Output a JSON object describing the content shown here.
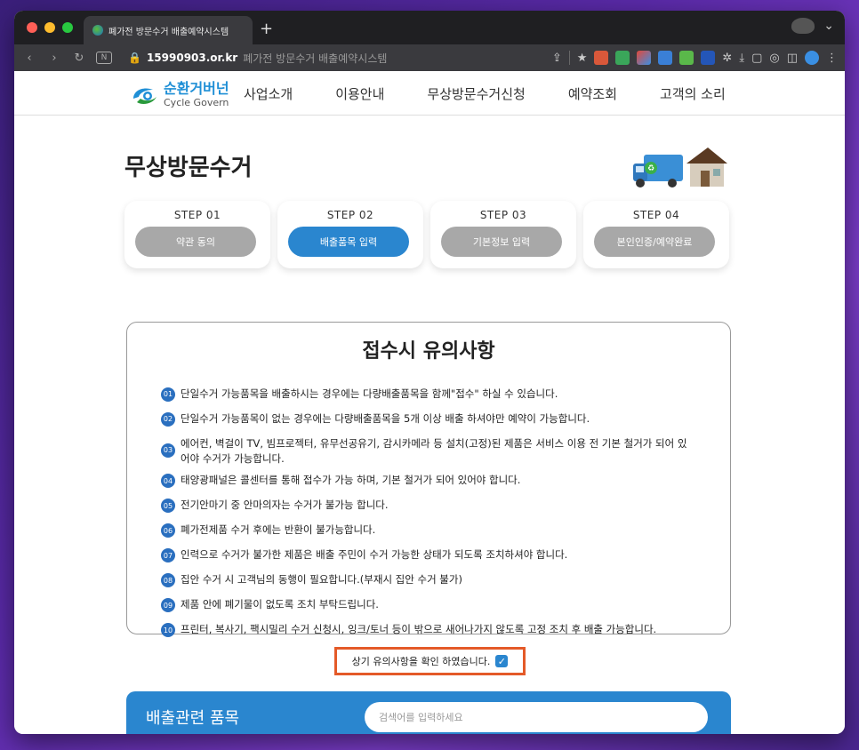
{
  "browser": {
    "tab_title": "폐가전 방문수거 배출예약시스템",
    "new_tab": "+",
    "url_host": "15990903.or.kr",
    "url_title": "폐가전 방문수거 배출예약시스템",
    "traffic_colors": [
      "#ff5f57",
      "#febc2e",
      "#28c840"
    ]
  },
  "site": {
    "logo_ko": "순환거버넌",
    "logo_en": "Cycle Govern",
    "nav": [
      "사업소개",
      "이용안내",
      "무상방문수거신청",
      "예약조회",
      "고객의 소리"
    ]
  },
  "page": {
    "title": "무상방문수거",
    "steps": [
      {
        "num": "STEP 01",
        "label": "약관 동의",
        "active": false
      },
      {
        "num": "STEP 02",
        "label": "배출품목 입력",
        "active": true
      },
      {
        "num": "STEP 03",
        "label": "기본정보 입력",
        "active": false
      },
      {
        "num": "STEP 04",
        "label": "본인인증/예약완료",
        "active": false
      }
    ],
    "step_arrow": "›"
  },
  "notice": {
    "title": "접수시 유의사항",
    "items": [
      {
        "n": "01",
        "text": "단일수거 가능품목을 배출하시는 경우에는 다량배출품목을 함께\"접수\" 하실 수 있습니다."
      },
      {
        "n": "02",
        "text": "단일수거 가능품목이 없는 경우에는 다량배출품목을 5개 이상 배출 하셔야만 예약이 가능합니다."
      },
      {
        "n": "03",
        "text": "에어컨, 벽걸이 TV, 빔프로젝터, 유무선공유기, 감시카메라 등 설치(고정)된 제품은 서비스 이용 전 기본 철거가 되어 있어야 수거가 가능합니다."
      },
      {
        "n": "04",
        "text": "태양광패널은 콜센터를 통해 접수가 가능 하며, 기본 철거가 되어 있어야 합니다."
      },
      {
        "n": "05",
        "text": "전기안마기 중 안마의자는 수거가 불가능 합니다."
      },
      {
        "n": "06",
        "text": "폐가전제품 수거 후에는 반환이 불가능합니다."
      },
      {
        "n": "07",
        "text": "인력으로 수거가 불가한 제품은 배출 주민이 수거 가능한 상태가 되도록 조치하셔야 합니다."
      },
      {
        "n": "08",
        "text": "집안 수거 시 고객님의 동행이 필요합니다.(부재시 집안 수거 불가)"
      },
      {
        "n": "09",
        "text": "제품 안에 폐기물이 없도록 조치 부탁드립니다."
      },
      {
        "n": "10",
        "text": "프린터, 복사기, 팩시밀리 수거 신청시, 잉크/토너 등이 밖으로 새어나가지 않도록 고정 조치 후 배출 가능합니다."
      }
    ]
  },
  "confirm": {
    "label": "상기 유의사항을 확인 하였습니다.",
    "checked": true
  },
  "items_section": {
    "title": "배출관련 품목",
    "search_placeholder": "검색어를 입력하세요"
  }
}
